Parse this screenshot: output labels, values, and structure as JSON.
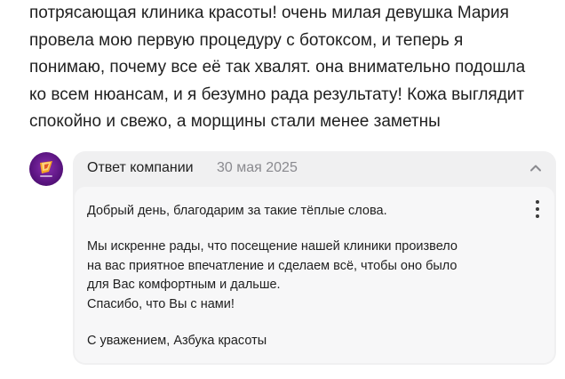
{
  "review": {
    "lines": [
      "потрясающая клиника красоты! очень милая девушка Мария",
      "провела мою первую процедуру с ботоксом, и теперь я",
      "понимаю, почему все её так хвалят. она внимательно подошла",
      "ко всем нюансам, и я безумно рада результату! Кожа выглядит",
      "спокойно и свежо, а морщины стали менее заметны"
    ]
  },
  "company_reply": {
    "author_label": "Ответ компании",
    "date": "30 мая 2025",
    "collapse_icon": "chevron-up-icon",
    "more_icon": "vertical-dots-icon",
    "paragraphs": {
      "greeting": "Добрый день, благодарим за такие тёплые слова.",
      "body_lines": [
        "Мы искренне рады, что посещение нашей клиники произвело",
        "на вас приятное впечатление и сделаем всё, чтобы оно было",
        "для Вас комфортным и дальше.",
        "Спасибо, что Вы с нами!"
      ],
      "signature": "С уважением, Азбука красоты"
    }
  },
  "colors": {
    "card_background": "#f0f0f1",
    "body_background": "#f7f7f8",
    "date_color": "#8a8a8f",
    "avatar_primary": "#6a1a94",
    "avatar_accent": "#f5a623"
  }
}
